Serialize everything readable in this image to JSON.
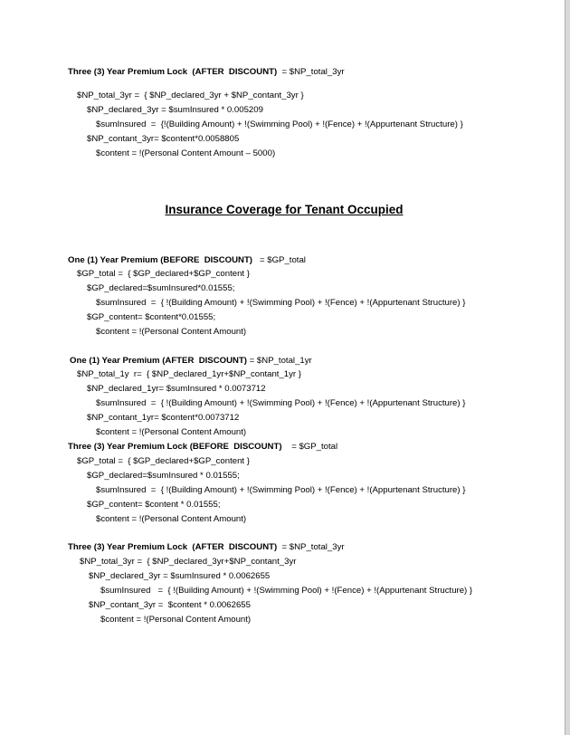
{
  "section1": {
    "title_bold": "Three (3) Year Premium Lock  (AFTER  DISCOUNT)",
    "title_rest": "  = $NP_total_3yr",
    "lines": [
      "$NP_total_3yr =  { $NP_declared_3yr + $NP_contant_3yr }",
      "$NP_declared_3yr = $sumInsured * 0.005209",
      "$sumInsured  =  {!(Building Amount) + !(Swimming Pool) + !(Fence) + !(Appurtenant Structure) }",
      "$NP_contant_3yr= $content*0.0058805",
      "$content = !(Personal Content Amount – 5000)"
    ]
  },
  "heading": "Insurance Coverage for Tenant Occupied",
  "section2": {
    "title_bold": "One (1) Year Premium (BEFORE  DISCOUNT)",
    "title_rest": "   = $GP_total",
    "lines": [
      "$GP_total =  { $GP_declared+$GP_content }",
      "$GP_declared=$sumInsured*0.01555;",
      "$sumInsured  =  { !(Building Amount) + !(Swimming Pool) + !(Fence) + !(Appurtenant Structure) }",
      "$GP_content= $content*0.01555;",
      "$content = !(Personal Content Amount)"
    ]
  },
  "section3": {
    "title_bold": "One (1) Year Premium (AFTER  DISCOUNT)",
    "title_rest": " = $NP_total_1yr",
    "lines": [
      "$NP_total_1y  r=  { $NP_declared_1yr+$NP_contant_1yr }",
      "$NP_declared_1yr= $sumInsured * 0.0073712",
      "$sumInsured  =  { !(Building Amount) + !(Swimming Pool) + !(Fence) + !(Appurtenant Structure) }",
      "$NP_contant_1yr= $content*0.0073712",
      "$content = !(Personal Content Amount)"
    ]
  },
  "section4": {
    "title_bold": "Three (3) Year Premium Lock (BEFORE  DISCOUNT)",
    "title_rest": "    = $GP_total",
    "lines": [
      "$GP_total =  { $GP_declared+$GP_content }",
      "$GP_declared=$sumInsured * 0.01555;",
      "$sumInsured  =  { !(Building Amount) + !(Swimming Pool) + !(Fence) + !(Appurtenant Structure) }",
      "$GP_content= $content * 0.01555;",
      "$content = !(Personal Content Amount)"
    ]
  },
  "section5": {
    "title_bold": "Three (3) Year Premium Lock  (AFTER  DISCOUNT)",
    "title_rest": "  = $NP_total_3yr",
    "lines": [
      "$NP_total_3yr =  { $NP_declared_3yr+$NP_contant_3yr",
      "$NP_declared_3yr = $sumInsured * 0.0062655",
      "$sumInsured   =  { !(Building Amount) + !(Swimming Pool) + !(Fence) + !(Appurtenant Structure) }",
      "$NP_contant_3yr =  $content * 0.0062655",
      "$content = !(Personal Content Amount)"
    ]
  }
}
